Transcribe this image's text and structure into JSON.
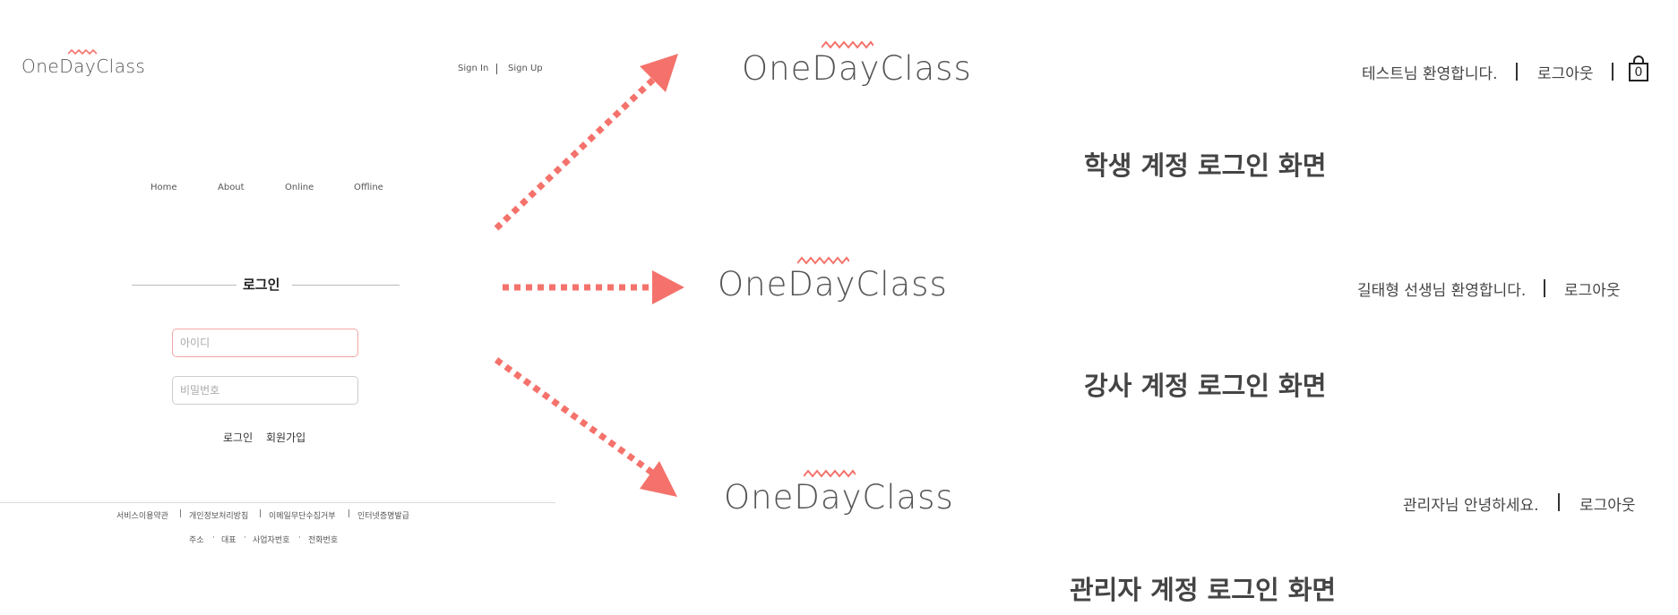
{
  "brand": "OneDayClass",
  "accent_color": "#f4726b",
  "left_page": {
    "top_links": {
      "sign_in": "Sign In",
      "sign_up": "Sign Up"
    },
    "menu": [
      "Home",
      "About",
      "Online",
      "Offline"
    ],
    "login_title": "로그인",
    "id_placeholder": "아이디",
    "pw_placeholder": "비밀번호",
    "login_button": "로그인",
    "signup_button": "회원가입",
    "footer_links": [
      "서비스이용약관",
      "개인정보처리방침",
      "이메일무단수집거부",
      "인터넷증명발급"
    ],
    "footer_info": [
      "주소",
      "대표",
      "사업자번호",
      "전화번호"
    ]
  },
  "results": [
    {
      "welcome": "테스트님 환영합니다.",
      "logout": "로그아웃",
      "cart_icon": "shopping-bag-icon",
      "cart_count": "0",
      "caption": "학생 계정 로그인 화면"
    },
    {
      "welcome": "길태형 선생님 환영합니다.",
      "logout": "로그아웃",
      "caption": "강사 계정 로그인 화면"
    },
    {
      "welcome": "관리자님 안녕하세요.",
      "logout": "로그아웃",
      "caption": "관리자 계정 로그인 화면"
    }
  ]
}
